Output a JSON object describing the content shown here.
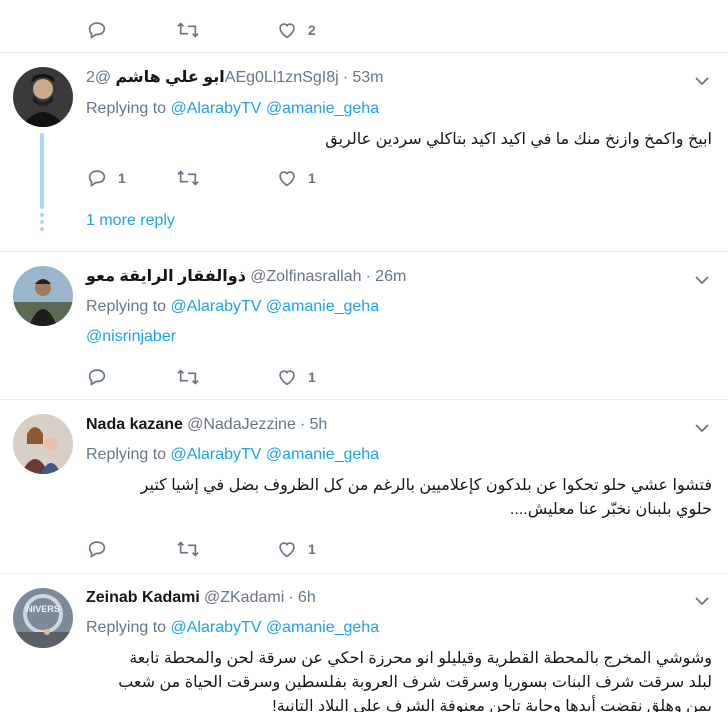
{
  "top_actions": {
    "reply_count": "",
    "retweet_count": "",
    "like_count": "2"
  },
  "tweets": [
    {
      "name": "ابو علي هاشم",
      "handle": "@2AEg0Ll1znSgI8j",
      "time": "53m",
      "replying_prefix": "Replying to",
      "mention1": "@AlarabyTV",
      "mention2": "@amanie_geha",
      "body_lines": [
        "ابيخ  واكمخ وازنخ  منك  ما في اكيد اكيد بتاكلي سردين عالريق"
      ],
      "reply_count": "1",
      "retweet_count": "",
      "like_count": "1",
      "more_reply": "1 more reply"
    },
    {
      "name": "ذوالفقار الرايقة معو",
      "handle": "@Zolfinasrallah",
      "time": "26m",
      "replying_prefix": "Replying to",
      "mention1": "@AlarabyTV",
      "mention2": "@amanie_geha",
      "body_lines": [
        "@nisrinjaber"
      ],
      "reply_count": "",
      "retweet_count": "",
      "like_count": "1"
    },
    {
      "name": "Nada kazane",
      "handle": "@NadaJezzine",
      "time": "5h",
      "replying_prefix": "Replying to",
      "mention1": "@AlarabyTV",
      "mention2": "@amanie_geha",
      "body_lines": [
        "فتشوا عشي حلو تحكوا عن بلدكون كإعلاميين بالرغم من كل الظروف بضل في إشيا كتير",
        "حلوي بلبنان نخبّر عنا معليش...."
      ],
      "reply_count": "",
      "retweet_count": "",
      "like_count": "1"
    },
    {
      "name": "Zeinab Kadami",
      "handle": "@ZKadami",
      "time": "6h",
      "replying_prefix": "Replying to",
      "mention1": "@AlarabyTV",
      "mention2": "@amanie_geha",
      "body_lines": [
        "وشوشي المخرج بالمحطة القطرية وقيليلو انو محرزة احكي عن سرقة لحن والمحطة تابعة",
        "لبلد  سرقت شرف البنات بسوريا وسرقت شرف العروبة بفلسطين وسرقت الحياة من شعب",
        "يمن وهلق نقضت أيدها وجاية تاحن معنوفة الشرف على البلاد التانية!"
      ]
    }
  ],
  "colors": {
    "link": "#1da1f2",
    "muted": "#657786",
    "thread": "#a7dbf5"
  },
  "icons": [
    "reply-icon",
    "retweet-icon",
    "like-icon",
    "chevron-down-icon"
  ]
}
